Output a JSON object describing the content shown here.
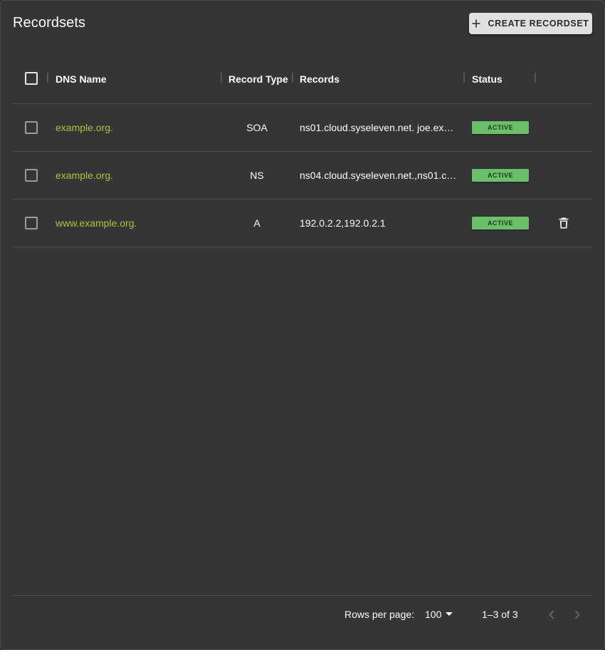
{
  "header": {
    "title": "Recordsets",
    "create_button_label": "CREATE RECORDSET",
    "create_icon": "plus-icon"
  },
  "table": {
    "columns": [
      "DNS Name",
      "Record Type",
      "Records",
      "Status"
    ],
    "rows": [
      {
        "dns_name": "example.org.",
        "record_type": "SOA",
        "records": "ns01.cloud.syseleven.net. joe.ex…",
        "status": "ACTIVE",
        "deletable": false
      },
      {
        "dns_name": "example.org.",
        "record_type": "NS",
        "records": "ns04.cloud.syseleven.net.,ns01.c…",
        "status": "ACTIVE",
        "deletable": false
      },
      {
        "dns_name": "www.example.org.",
        "record_type": "A",
        "records": "192.0.2.2,192.0.2.1",
        "status": "ACTIVE",
        "deletable": true
      }
    ]
  },
  "pagination": {
    "rows_per_page_label": "Rows per page:",
    "rows_per_page_value": "100",
    "range_text": "1–3 of 3"
  },
  "colors": {
    "panel_background": "#353535",
    "link": "#a5c63b",
    "status_active": "#6abf69",
    "button_background": "#e0e0e0"
  }
}
